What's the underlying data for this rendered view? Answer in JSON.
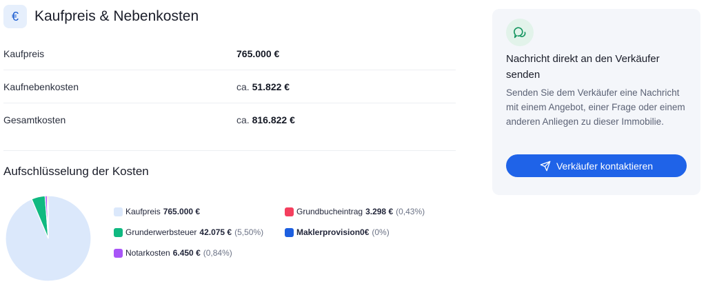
{
  "header": {
    "icon": "euro-icon",
    "icon_glyph": "€",
    "title": "Kaufpreis & Nebenkosten"
  },
  "costs": [
    {
      "label": "Kaufpreis",
      "prefix": "",
      "value": "765.000 €"
    },
    {
      "label": "Kaufnebenkosten",
      "prefix": "ca.",
      "value": "51.822 €"
    },
    {
      "label": "Gesamtkosten",
      "prefix": "ca.",
      "value": "816.822 €"
    }
  ],
  "breakdown": {
    "title": "Aufschlüsselung der Kosten",
    "legend": [
      {
        "name": "Kaufpreis",
        "amount": "765.000 €",
        "percent": "",
        "color": "#dbe8fb"
      },
      {
        "name": "Grunderwerbsteuer",
        "amount": "42.075 €",
        "percent": "(5,50%)",
        "color": "#10b981"
      },
      {
        "name": "Notarkosten",
        "amount": "6.450 €",
        "percent": "(0,84%)",
        "color": "#a855f7"
      },
      {
        "name": "Grundbucheintrag",
        "amount": "3.298 €",
        "percent": "(0,43%)",
        "color": "#f43f5e"
      },
      {
        "name": "Maklerprovision",
        "amount": "0€",
        "percent": "(0%)",
        "color": "#1d5fe0"
      }
    ]
  },
  "chart_data": {
    "type": "pie",
    "categories": [
      "Kaufpreis",
      "Grunderwerbsteuer",
      "Notarkosten",
      "Grundbucheintrag",
      "Maklerprovision"
    ],
    "values": [
      765000,
      42075,
      6450,
      3298,
      0
    ],
    "title": "Aufschlüsselung der Kosten",
    "legend_placement": "right"
  },
  "contact": {
    "icon": "chat-bubble-icon",
    "title": "Nachricht direkt an den Verkäufer senden",
    "text": "Senden Sie dem Verkäufer eine Nachricht mit einem Angebot, einer Frage oder einem anderen Anliegen zu dieser Immobilie.",
    "button_icon": "send-icon",
    "button_label": "Verkäufer kontaktieren"
  }
}
